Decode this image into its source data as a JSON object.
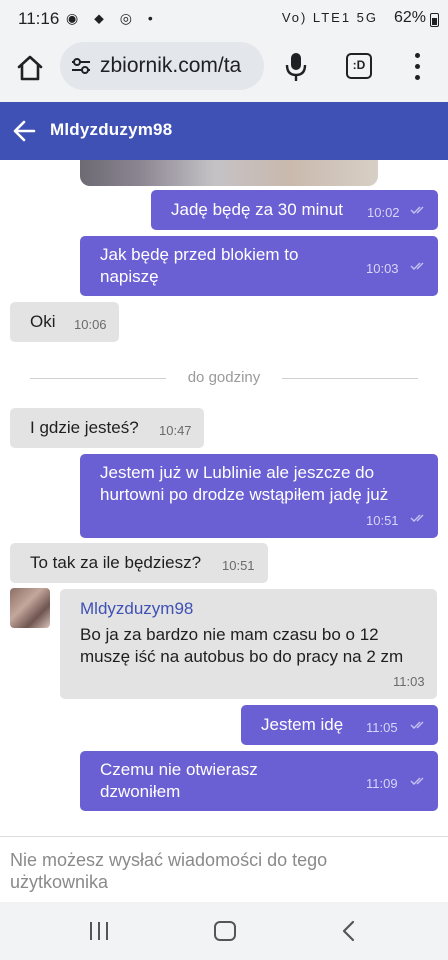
{
  "status_bar": {
    "time": "11:16",
    "left_icons": [
      "notification-icon",
      "navigation-icon",
      "location-icon",
      "chrome-icon",
      "dot-icon"
    ],
    "network": "Vo) LTE1 5G",
    "battery": "62%"
  },
  "browser": {
    "url": "zbiornik.com/ta",
    "tab_label": ":D"
  },
  "header": {
    "title": "Mldyzduzym98"
  },
  "messages": [
    {
      "dir": "out",
      "text": "Jadę będę za 30 minut",
      "time": "10:02",
      "ticks": true
    },
    {
      "dir": "out",
      "text": "Jak będę przed blokiem to napiszę",
      "time": "10:03",
      "ticks": true
    },
    {
      "dir": "in",
      "text": "Oki",
      "time": "10:06"
    },
    {
      "dir": "in",
      "text": "I gdzie jesteś?",
      "time": "10:47"
    },
    {
      "dir": "out",
      "text": "Jestem już w Lublinie ale jeszcze do hurtowni po drodze wstąpiłem jadę już",
      "time": "10:51",
      "ticks": true
    },
    {
      "dir": "in",
      "text": "To tak za ile będziesz?",
      "time": "10:51"
    },
    {
      "dir": "in",
      "sender": "Mldyzduzym98",
      "text": "Bo ja za bardzo nie mam czasu bo o 12 muszę iść na autobus bo do pracy na 2 zm",
      "time": "11:03"
    },
    {
      "dir": "out",
      "text": "Jestem idę",
      "time": "11:05",
      "ticks": true
    },
    {
      "dir": "out",
      "text": "Czemu nie otwierasz dzwoniłem",
      "time": "11:09",
      "ticks": true
    }
  ],
  "divider": {
    "label": "do godziny"
  },
  "footer": {
    "notice": "Nie możesz wysłać wiadomości do tego użytkownika"
  },
  "colors": {
    "header_bg": "#3f51b5",
    "outgoing_bubble": "#6a5fd3",
    "incoming_bubble": "#e3e3e3",
    "sender_name": "#3f51b5"
  }
}
